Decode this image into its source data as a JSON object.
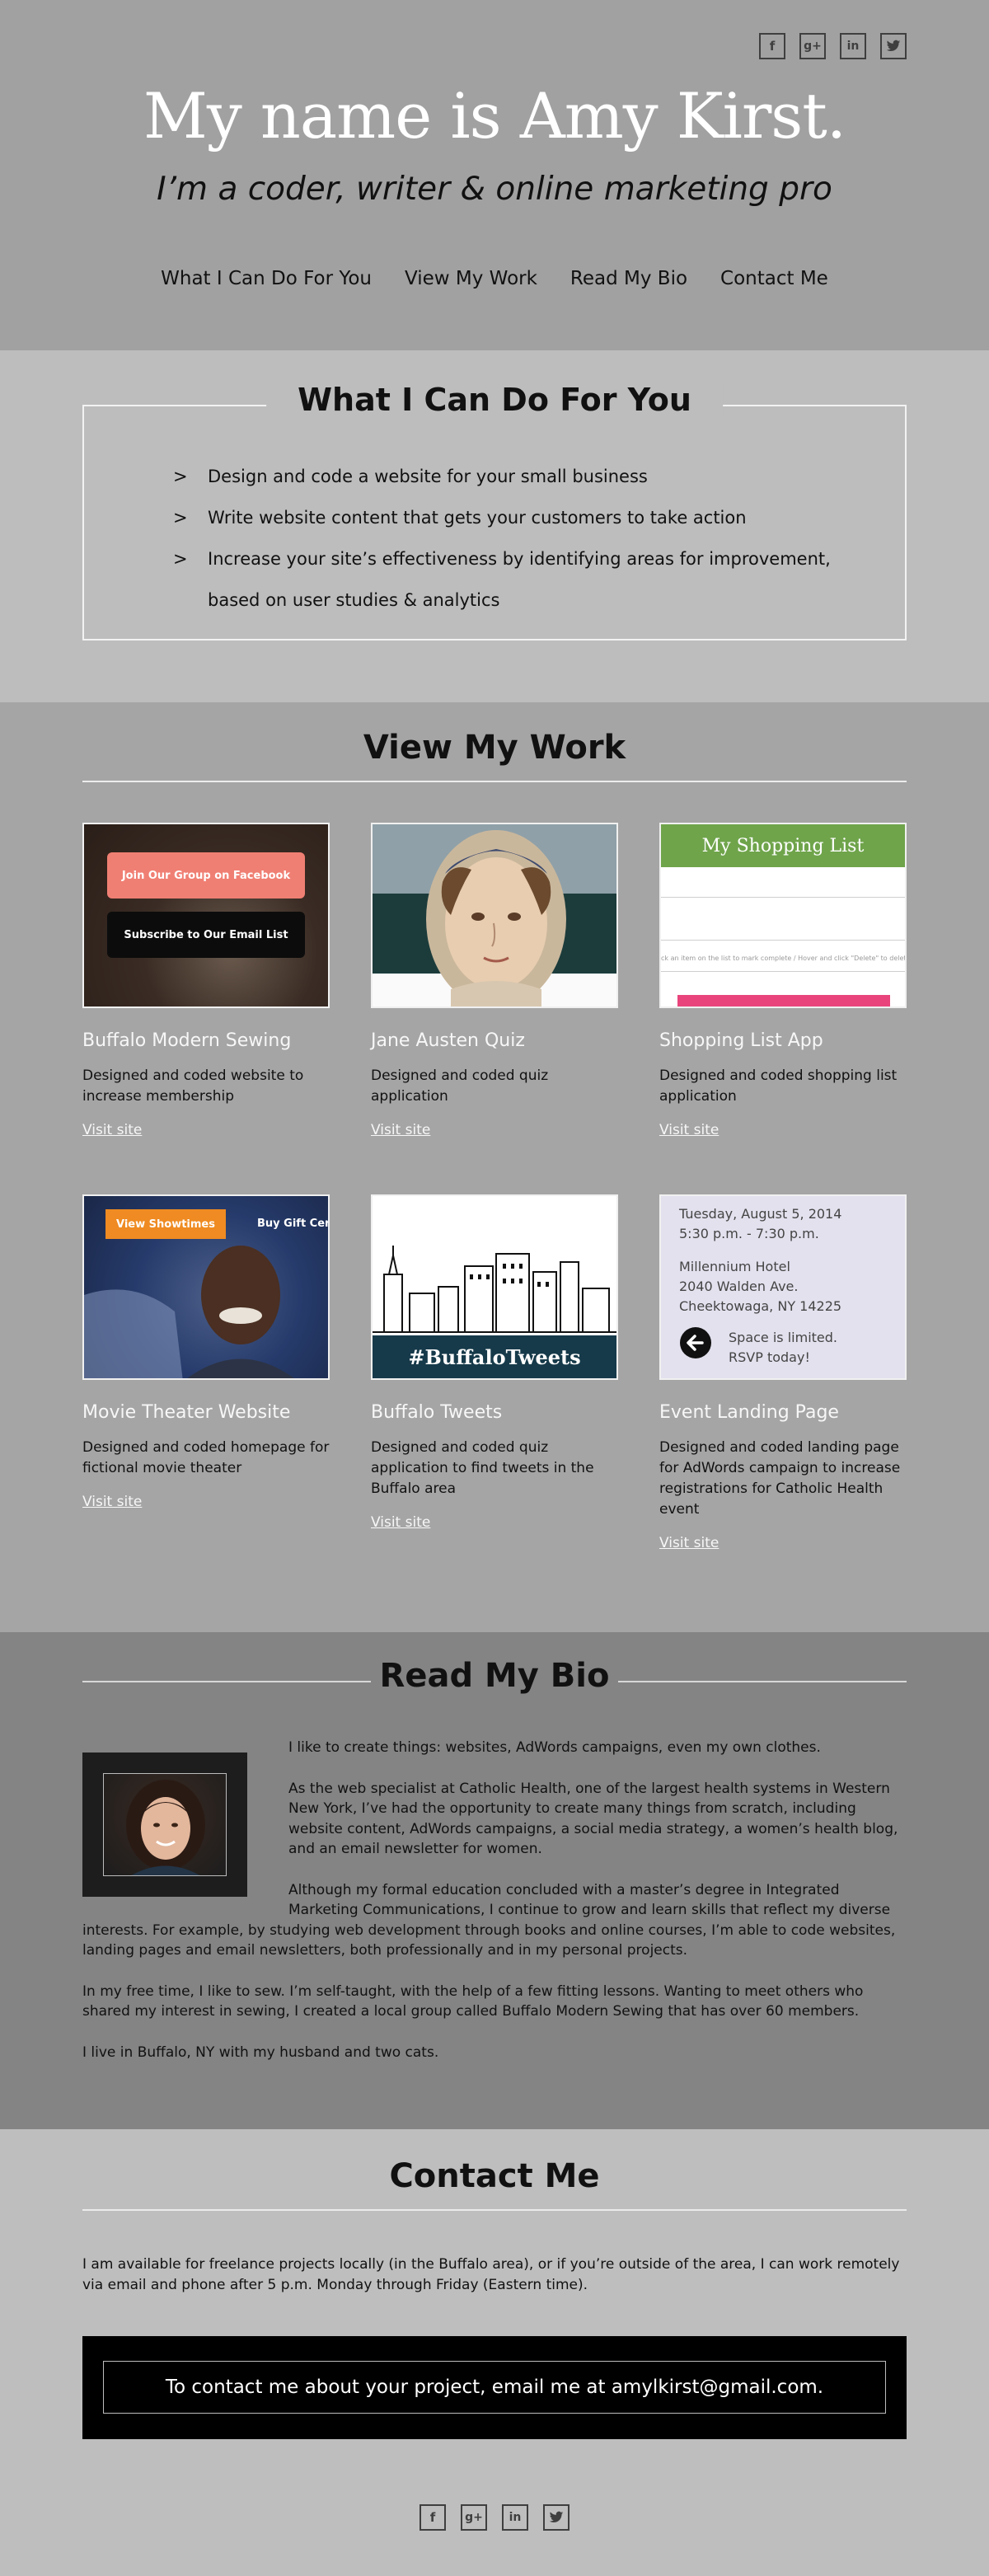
{
  "header": {
    "title": "My name is Amy Kirst.",
    "subtitle": "I’m a coder, writer & online marketing pro",
    "nav": [
      "What I Can Do For You",
      "View My Work",
      "Read My Bio",
      "Contact Me"
    ],
    "social": [
      "f",
      "g+",
      "in",
      "twitter"
    ]
  },
  "services": {
    "title": "What I Can Do For You",
    "items": [
      "Design and code a website for your small business",
      "Write website content that gets your customers to take action",
      "Increase your site’s effectiveness by identifying areas for improvement, based on user studies & analytics"
    ]
  },
  "work": {
    "title": "View My Work",
    "link_label": "Visit site",
    "projects": [
      {
        "title": "Buffalo Modern Sewing",
        "desc": "Designed and coded website to increase membership",
        "thumb": {
          "btn1": "Join Our Group on Facebook",
          "btn2": "Subscribe to Our Email List"
        }
      },
      {
        "title": "Jane Austen Quiz",
        "desc": "Designed and coded quiz application"
      },
      {
        "title": "Shopping List App",
        "desc": "Designed and coded shopping list application",
        "thumb": {
          "header": "My Shopping List",
          "hint": "ck an item on the list to mark complete   /   Hover and click \"Delete\" to delete an item"
        }
      },
      {
        "title": "Movie Theater Website",
        "desc": "Designed and coded homepage for fictional movie theater",
        "thumb": {
          "btn": "View Showtimes",
          "gift": "Buy Gift Cer"
        }
      },
      {
        "title": "Buffalo Tweets",
        "desc": "Designed and coded quiz application to find tweets in the Buffalo area",
        "thumb": {
          "banner": "#BuffaloTweets"
        }
      },
      {
        "title": "Event Landing Page",
        "desc": "Designed and coded landing page for AdWords campaign to increase registrations for Catholic Health event",
        "thumb": {
          "date": "Tuesday, August 5, 2014",
          "time": "5:30 p.m. - 7:30 p.m.",
          "venue": "Millennium Hotel",
          "street": "2040 Walden Ave.",
          "city": "Cheektowaga, NY 14225",
          "limited1": "Space is limited.",
          "limited2": "RSVP today!"
        }
      }
    ]
  },
  "bio": {
    "title": "Read My Bio",
    "paragraphs": [
      "I like to create things: websites, AdWords campaigns, even my own clothes.",
      "As the web specialist at Catholic Health, one of the largest health systems in Western New York, I’ve had the opportunity to create many things from scratch, including website content, AdWords campaigns, a social media strategy, a women’s health blog, and an email newsletter for women.",
      "Although my formal education concluded with a master’s degree in Integrated Marketing Communications, I continue to grow and learn skills that reflect my diverse interests. For example, by studying web development through books and online courses, I’m able to code websites, landing pages and email newsletters, both professionally and in my personal projects.",
      "In my free time, I like to sew. I’m self-taught, with the help of a few fitting lessons. Wanting to meet others who shared my interest in sewing, I created a local group called Buffalo Modern Sewing that has over 60 members.",
      "I live in Buffalo, NY with my husband and two cats."
    ]
  },
  "contact": {
    "title": "Contact Me",
    "text": "I am available for freelance projects locally (in the Buffalo area), or if you’re outside of the area, I can work remotely via email and phone after 5 p.m. Monday through Friday (Eastern time).",
    "cta": "To contact me about your project, email me at amylkirst@gmail.com."
  }
}
